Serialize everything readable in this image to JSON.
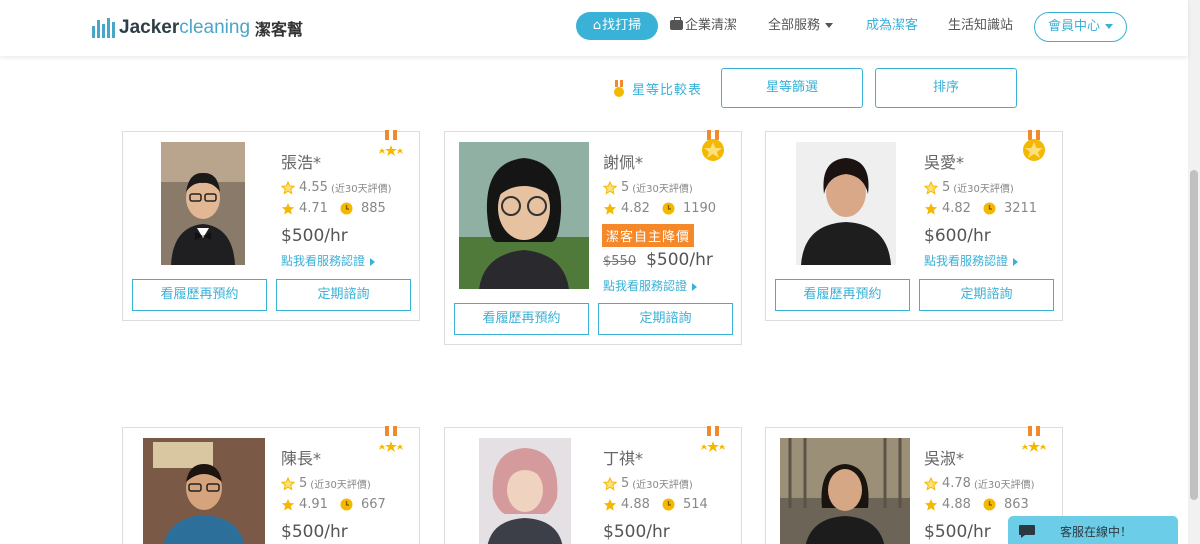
{
  "brand": {
    "name_a": "Jacker",
    "name_b": "cleaning",
    "name_cn": "潔客幫"
  },
  "nav": {
    "book": "找打掃",
    "enterprise": "企業清潔",
    "services": "全部服務",
    "join": "成為潔客",
    "tips": "生活知識站",
    "member": "會員中心"
  },
  "filters": {
    "compare": "星等比較表",
    "star_filter": "星等篩選",
    "sort": "排序"
  },
  "labels": {
    "reviews_30": "(近30天評價)",
    "certify": "點我看服務認證",
    "rebook": "看履歷再預約",
    "consult": "定期諮詢",
    "self_discount": "潔客自主降價"
  },
  "cleaners": [
    {
      "name": "張浩*",
      "rating_30": "4.55",
      "rating_all": "4.71",
      "jobs": "885",
      "price": "$500/hr"
    },
    {
      "name": "謝佩*",
      "rating_30": "5",
      "rating_all": "4.82",
      "jobs": "1190",
      "old_price": "$550",
      "price": "$500/hr"
    },
    {
      "name": "吳愛*",
      "rating_30": "5",
      "rating_all": "4.82",
      "jobs": "3211",
      "price": "$600/hr"
    },
    {
      "name": "陳長*",
      "rating_30": "5",
      "rating_all": "4.91",
      "jobs": "667",
      "price": "$500/hr"
    },
    {
      "name": "丁祺*",
      "rating_30": "5",
      "rating_all": "4.88",
      "jobs": "514",
      "price": "$500/hr"
    },
    {
      "name": "吳淑*",
      "rating_30": "4.78",
      "rating_all": "4.88",
      "jobs": "863",
      "price": "$500/hr"
    }
  ],
  "chat": {
    "label": "客服在線中！"
  },
  "colors": {
    "accent": "#3ab1d6",
    "sale": "#f5892a",
    "star": "#f5b800",
    "chat": "#6ccde8"
  }
}
